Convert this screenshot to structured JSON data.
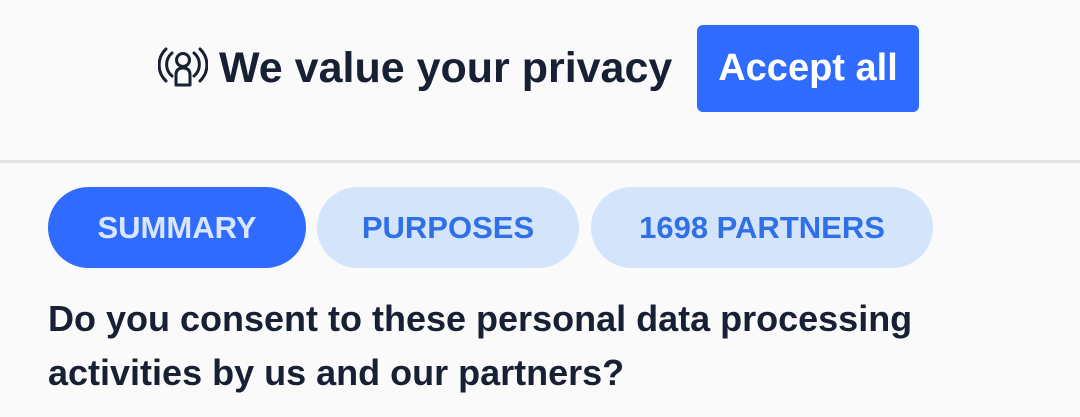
{
  "header": {
    "title": "We value your privacy",
    "icon": "privacy-person-broadcast-icon",
    "accept_label": "Accept all"
  },
  "tabs": [
    {
      "label": "SUMMARY",
      "active": true
    },
    {
      "label": "PURPOSES",
      "active": false
    },
    {
      "label": "1698 PARTNERS",
      "active": false
    }
  ],
  "content": {
    "question": "Do you consent to these personal data processing activities by us and our partners?"
  },
  "colors": {
    "accent": "#2f6bff",
    "tab_inactive_bg": "#d4e5fb",
    "tab_inactive_text": "#2f6fe8",
    "text_dark": "#182033",
    "background": "#fafafb"
  }
}
